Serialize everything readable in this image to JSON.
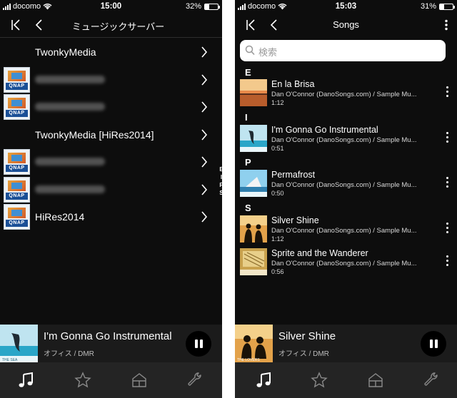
{
  "left_screen": {
    "status": {
      "carrier": "docomo",
      "time": "15:00",
      "battery": "32%",
      "battery_fraction": 0.32
    },
    "nav": {
      "title": "ミュージックサーバー"
    },
    "servers": [
      {
        "label": "TwonkyMedia",
        "icon": "none",
        "blurred": false
      },
      {
        "label": "",
        "icon": "qnap-logo",
        "blurred": true
      },
      {
        "label": "",
        "icon": "qnap-logo",
        "blurred": true
      },
      {
        "label": "TwonkyMedia [HiRes2014]",
        "icon": "none",
        "blurred": false
      },
      {
        "label": "",
        "icon": "qnap-logo",
        "blurred": true
      },
      {
        "label": "",
        "icon": "qnap-logo",
        "blurred": true
      },
      {
        "label": "HiRes2014",
        "icon": "qnap-logo",
        "blurred": false
      }
    ],
    "now_playing": {
      "title": "I'm Gonna Go Instrumental",
      "subtitle": "オフィス / DMR"
    }
  },
  "right_screen": {
    "status": {
      "carrier": "docomo",
      "time": "15:03",
      "battery": "31%",
      "battery_fraction": 0.31
    },
    "nav": {
      "title": "Songs"
    },
    "search": {
      "placeholder": "検索"
    },
    "sections": [
      {
        "letter": "E",
        "songs": [
          {
            "title": "En la Brisa",
            "artist": "Dan O'Connor (DanoSongs.com) / Sample Mu...",
            "duration": "1:12"
          }
        ]
      },
      {
        "letter": "I",
        "songs": [
          {
            "title": "I'm Gonna Go Instrumental",
            "artist": "Dan O'Connor (DanoSongs.com) / Sample Mu...",
            "duration": "0:51"
          }
        ]
      },
      {
        "letter": "P",
        "songs": [
          {
            "title": "Permafrost",
            "artist": "Dan O'Connor (DanoSongs.com) / Sample Mu...",
            "duration": "0:50"
          }
        ]
      },
      {
        "letter": "S",
        "songs": [
          {
            "title": "Silver Shine",
            "artist": "Dan O'Connor (DanoSongs.com) / Sample Mu...",
            "duration": "1:12"
          },
          {
            "title": "Sprite and the Wanderer",
            "artist": "Dan O'Connor (DanoSongs.com) / Sample Mu...",
            "duration": "0:56"
          }
        ]
      }
    ],
    "section_index": [
      "E",
      "I",
      "P",
      "S"
    ],
    "now_playing": {
      "title": "Silver Shine",
      "subtitle": "オフィス / DMR"
    }
  },
  "tabs": [
    {
      "icon": "music-note-icon",
      "active": true
    },
    {
      "icon": "star-icon",
      "active": false
    },
    {
      "icon": "room-icon",
      "active": false
    },
    {
      "icon": "wrench-icon",
      "active": false
    }
  ],
  "colors": {
    "background": "#0d0d0d",
    "tabbar": "#242424",
    "now_playing": "#1b1b1b",
    "accent": "#ffffff"
  }
}
